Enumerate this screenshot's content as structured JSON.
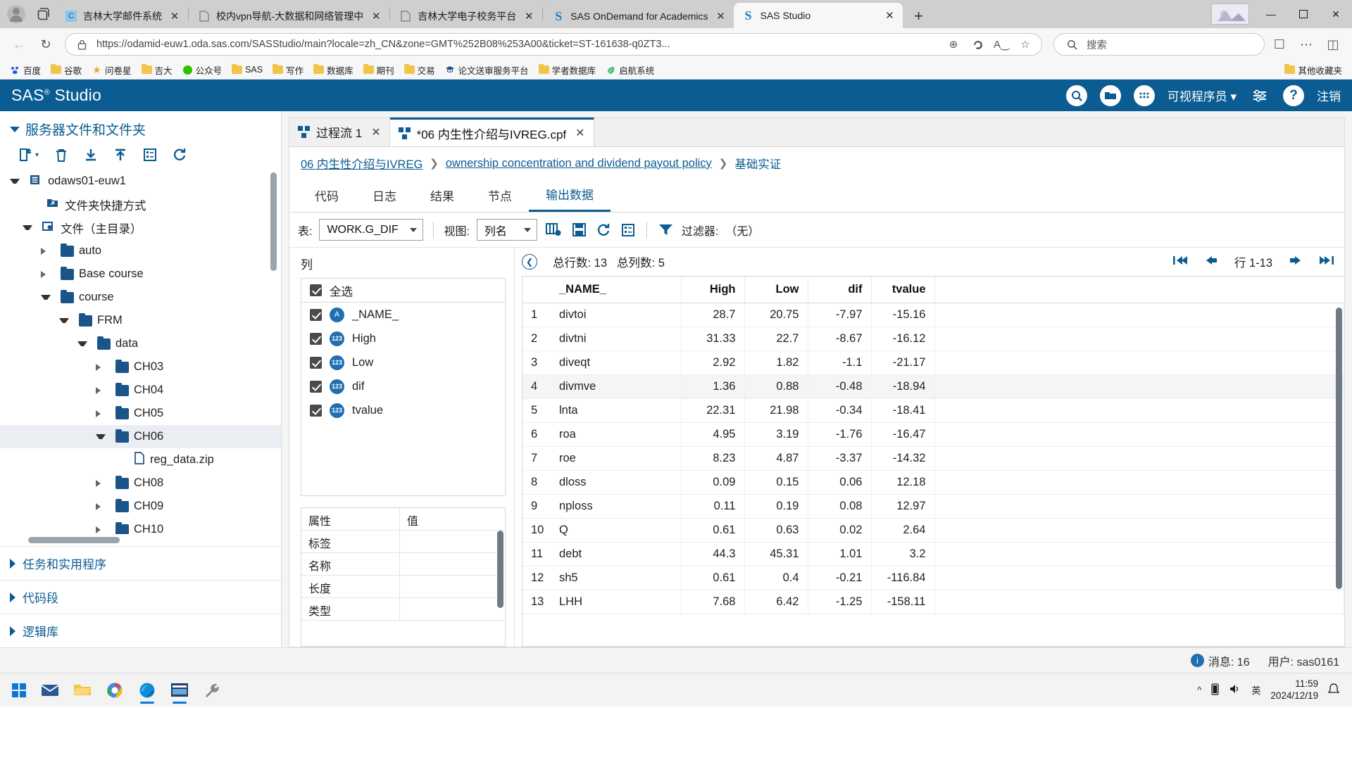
{
  "browser": {
    "tabs": [
      {
        "title": "吉林大学邮件系统",
        "favicon": "c-mail-icon",
        "active": false
      },
      {
        "title": "校内vpn导航-大数据和网络管理中",
        "favicon": "page-icon",
        "active": false
      },
      {
        "title": "吉林大学电子校务平台",
        "favicon": "page-icon",
        "active": false
      },
      {
        "title": "SAS OnDemand for Academics",
        "favicon": "sas-icon",
        "active": false
      },
      {
        "title": "SAS Studio",
        "favicon": "sas-icon",
        "active": true
      }
    ],
    "new_tab_label": "+",
    "window_controls": {
      "minimize": "—",
      "maximize": "❐",
      "close": "✕"
    },
    "url": "https://odamid-euw1.oda.sas.com/SASStudio/main?locale=zh_CN&zone=GMT%252B08%253A00&ticket=ST-161638-q0ZT3...",
    "search_placeholder": "搜索",
    "bookmarks": [
      {
        "label": "百度",
        "icon": "baidu-icon"
      },
      {
        "label": "谷歌",
        "icon": "folder-icon"
      },
      {
        "label": "问卷星",
        "icon": "star-icon"
      },
      {
        "label": "吉大",
        "icon": "folder-icon"
      },
      {
        "label": "公众号",
        "icon": "wechat-icon"
      },
      {
        "label": "SAS",
        "icon": "folder-icon"
      },
      {
        "label": "写作",
        "icon": "folder-icon"
      },
      {
        "label": "数据库",
        "icon": "folder-icon"
      },
      {
        "label": "期刊",
        "icon": "folder-icon"
      },
      {
        "label": "交易",
        "icon": "folder-icon"
      },
      {
        "label": "论文送审服务平台",
        "icon": "graduation-icon"
      },
      {
        "label": "学者数据库",
        "icon": "folder-icon"
      },
      {
        "label": "启航系统",
        "icon": "leaf-icon"
      }
    ],
    "other_bookmarks": {
      "label": "其他收藏夹",
      "icon": "folder-icon"
    }
  },
  "sas": {
    "app_title": "SAS",
    "app_title_sup": "®",
    "app_title_rest": "Studio",
    "header": {
      "search_icon": "search-icon",
      "open_icon": "folder-open-icon",
      "apps_icon": "grid-apps-icon",
      "mode_label": "可视程序员",
      "options_icon": "options-icon",
      "help_icon": "help-icon",
      "signout_label": "注销"
    },
    "sidebar": {
      "section_title": "服务器文件和文件夹",
      "toolbar_icons": [
        "new-file-icon",
        "delete-icon",
        "download-icon",
        "upload-icon",
        "properties-icon",
        "refresh-icon"
      ],
      "tree": [
        {
          "label": "odaws01-euw1",
          "depth": 0,
          "state": "open",
          "icon": "server-icon"
        },
        {
          "label": "文件夹快捷方式",
          "depth": 1,
          "state": "none",
          "icon": "shortcut-folder-icon"
        },
        {
          "label": "文件（主目录）",
          "depth": 1,
          "state": "open",
          "icon": "home-folder-icon"
        },
        {
          "label": "auto",
          "depth": 2,
          "state": "closed",
          "icon": "folder-icon"
        },
        {
          "label": "Base course",
          "depth": 2,
          "state": "closed",
          "icon": "folder-icon"
        },
        {
          "label": "course",
          "depth": 2,
          "state": "open",
          "icon": "folder-icon"
        },
        {
          "label": "FRM",
          "depth": 3,
          "state": "open",
          "icon": "folder-icon"
        },
        {
          "label": "data",
          "depth": 4,
          "state": "open",
          "icon": "folder-icon"
        },
        {
          "label": "CH03",
          "depth": 5,
          "state": "closed",
          "icon": "folder-icon"
        },
        {
          "label": "CH04",
          "depth": 5,
          "state": "closed",
          "icon": "folder-icon"
        },
        {
          "label": "CH05",
          "depth": 5,
          "state": "closed",
          "icon": "folder-icon"
        },
        {
          "label": "CH06",
          "depth": 5,
          "state": "open",
          "icon": "folder-icon",
          "selected": true
        },
        {
          "label": "reg_data.zip",
          "depth": 6,
          "state": "none",
          "icon": "file-icon"
        },
        {
          "label": "CH08",
          "depth": 5,
          "state": "closed",
          "icon": "folder-icon"
        },
        {
          "label": "CH09",
          "depth": 5,
          "state": "closed",
          "icon": "folder-icon"
        },
        {
          "label": "CH10",
          "depth": 5,
          "state": "closed",
          "icon": "folder-icon"
        }
      ],
      "collapsed_sections": [
        "任务和实用程序",
        "代码段",
        "逻辑库"
      ]
    },
    "work": {
      "doc_tabs": [
        {
          "label": "过程流 1",
          "active": false,
          "close": "✕"
        },
        {
          "label": "*06 内生性介绍与IVREG.cpf",
          "active": true,
          "close": "✕"
        }
      ],
      "breadcrumb": [
        "06 内生性介绍与IVREG",
        "ownership concentration and dividend payout policy",
        "基础实证"
      ],
      "breadcrumb_sep": "❯",
      "inner_tabs": [
        {
          "label": "代码",
          "active": false
        },
        {
          "label": "日志",
          "active": false
        },
        {
          "label": "结果",
          "active": false
        },
        {
          "label": "节点",
          "active": false
        },
        {
          "label": "输出数据",
          "active": true
        }
      ],
      "data_toolbar": {
        "table_label": "表:",
        "table_value": "WORK.G_DIF",
        "view_label": "视图:",
        "view_value": "列名",
        "icons": [
          "select-columns-icon",
          "save-icon",
          "refresh-icon",
          "properties-icon",
          "filter-icon"
        ],
        "filter_label": "过滤器:",
        "filter_value": "（无）"
      },
      "columns_panel": {
        "title": "列",
        "select_all_label": "全选",
        "items": [
          {
            "label": "_NAME_",
            "type": "char",
            "type_badge": "A",
            "checked": true
          },
          {
            "label": "High",
            "type": "num",
            "type_badge": "123",
            "checked": true
          },
          {
            "label": "Low",
            "type": "num",
            "type_badge": "123",
            "checked": true
          },
          {
            "label": "dif",
            "type": "num",
            "type_badge": "123",
            "checked": true
          },
          {
            "label": "tvalue",
            "type": "num",
            "type_badge": "123",
            "checked": true
          }
        ]
      },
      "properties_panel": {
        "headers": [
          "属性",
          "值"
        ],
        "rows": [
          {
            "name": "标签",
            "value": ""
          },
          {
            "name": "名称",
            "value": ""
          },
          {
            "name": "长度",
            "value": ""
          },
          {
            "name": "类型",
            "value": ""
          }
        ]
      },
      "grid": {
        "collapse_icon": "collapse-left-icon",
        "total_rows_label": "总行数: 13",
        "total_cols_label": "总列数: 5",
        "pager": {
          "first_icon": "first-page-icon",
          "prev_icon": "prev-page-icon",
          "range_label": "行 1-13",
          "next_icon": "next-page-icon",
          "last_icon": "last-page-icon"
        }
      }
    }
  },
  "chart_data": {
    "type": "table",
    "title": "WORK.G_DIF",
    "columns": [
      "",
      "_NAME_",
      "High",
      "Low",
      "dif",
      "tvalue"
    ],
    "rows": [
      [
        "1",
        "divtoi",
        "28.7",
        "20.75",
        "-7.97",
        "-15.16"
      ],
      [
        "2",
        "divtni",
        "31.33",
        "22.7",
        "-8.67",
        "-16.12"
      ],
      [
        "3",
        "diveqt",
        "2.92",
        "1.82",
        "-1.1",
        "-21.17"
      ],
      [
        "4",
        "divmve",
        "1.36",
        "0.88",
        "-0.48",
        "-18.94"
      ],
      [
        "5",
        "lnta",
        "22.31",
        "21.98",
        "-0.34",
        "-18.41"
      ],
      [
        "6",
        "roa",
        "4.95",
        "3.19",
        "-1.76",
        "-16.47"
      ],
      [
        "7",
        "roe",
        "8.23",
        "4.87",
        "-3.37",
        "-14.32"
      ],
      [
        "8",
        "dloss",
        "0.09",
        "0.15",
        "0.06",
        "12.18"
      ],
      [
        "9",
        "nploss",
        "0.11",
        "0.19",
        "0.08",
        "12.97"
      ],
      [
        "10",
        "Q",
        "0.61",
        "0.63",
        "0.02",
        "2.64"
      ],
      [
        "11",
        "debt",
        "44.3",
        "45.31",
        "1.01",
        "3.2"
      ],
      [
        "12",
        "sh5",
        "0.61",
        "0.4",
        "-0.21",
        "-116.84"
      ],
      [
        "13",
        "LHH",
        "7.68",
        "6.42",
        "-1.25",
        "-158.11"
      ]
    ],
    "highlighted_row_index": 3
  },
  "status_bar": {
    "messages_label": "消息: 16",
    "user_label": "用户: sas0161"
  },
  "taskbar": {
    "apps": [
      "start-icon",
      "mail-app-icon",
      "explorer-app-icon",
      "chrome-app-icon",
      "edge-app-icon",
      "sas-app-icon",
      "tool-app-icon"
    ],
    "tray": {
      "chevron": "^",
      "battery_icon": "battery-icon",
      "volume_icon": "volume-icon",
      "ime_label": "英",
      "time": "11:59",
      "date": "2024/12/19",
      "notification_icon": "notification-icon"
    }
  }
}
